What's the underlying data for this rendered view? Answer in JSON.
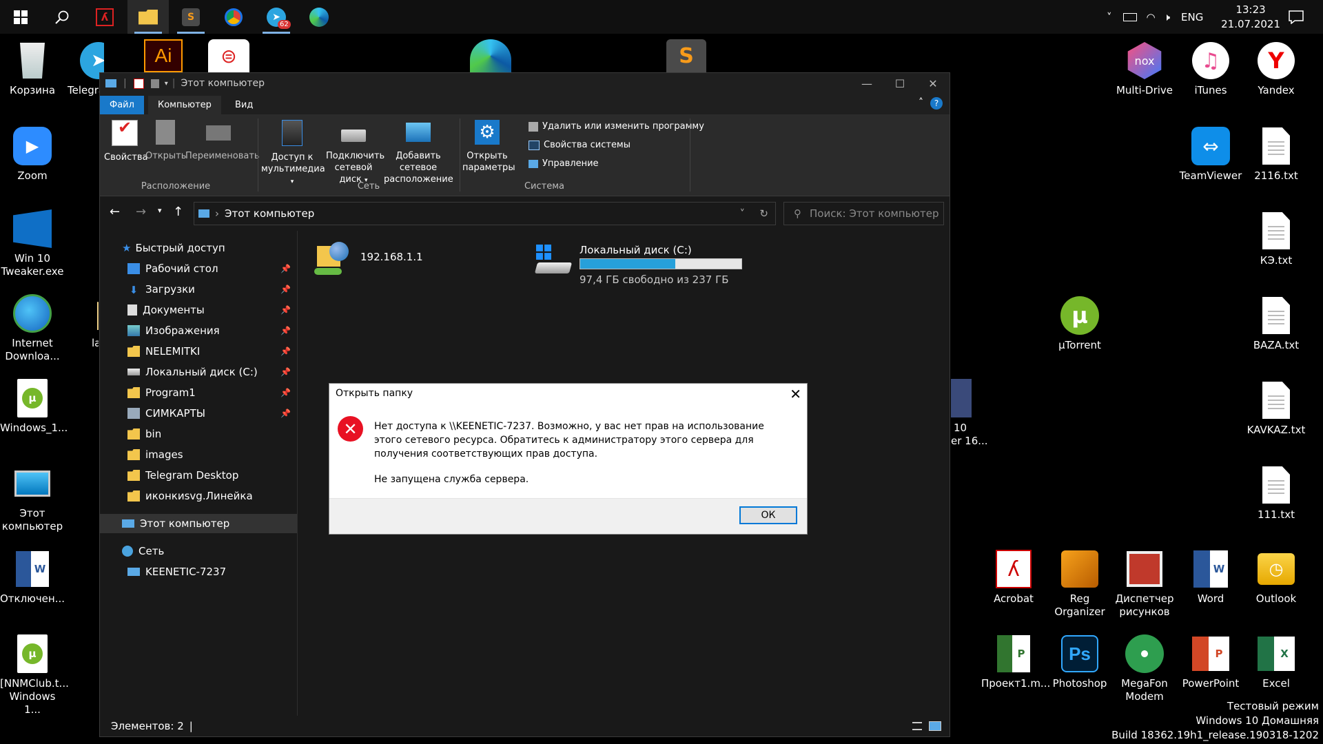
{
  "taskbar": {
    "language": "ENG",
    "time": "13:23",
    "date": "21.07.2021",
    "telegram_badge": "62"
  },
  "desktop_left": [
    {
      "label": "Корзина"
    },
    {
      "label": "Telegra"
    },
    {
      "label": "Zoom"
    },
    {
      "label": "Win 10 Tweaker.exe"
    },
    {
      "label": "Internet Downloa..."
    },
    {
      "label": "lavend"
    },
    {
      "label": "Windows_1..."
    },
    {
      "label": "Этот компьютер"
    },
    {
      "label": "Отключен..."
    },
    {
      "label": "[NNMClub.t... Windows 1..."
    }
  ],
  "desktop_right": [
    {
      "label": "Multi-Drive"
    },
    {
      "label": "iTunes"
    },
    {
      "label": "Yandex"
    },
    {
      "label": "TeamViewer"
    },
    {
      "label": "2116.txt"
    },
    {
      "label": "КЭ.txt"
    },
    {
      "label": "µTorrent"
    },
    {
      "label": "BAZA.txt"
    },
    {
      "label": "KAVKAZ.txt"
    },
    {
      "label": "111.txt"
    },
    {
      "label": "Acrobat"
    },
    {
      "label": "Reg Organizer"
    },
    {
      "label": "Диспетчер рисунков"
    },
    {
      "label": "Word"
    },
    {
      "label": "Outlook"
    },
    {
      "label": "Проект1.m..."
    },
    {
      "label": "Photoshop"
    },
    {
      "label": "MegaFon Modem"
    },
    {
      "label": "PowerPoint"
    },
    {
      "label": "Excel"
    }
  ],
  "partial_icon": {
    "line1": "10",
    "line2": "er 16..."
  },
  "explorer": {
    "title": "Этот компьютер",
    "tabs": {
      "file": "Файл",
      "computer": "Компьютер",
      "view": "Вид"
    },
    "ribbon": {
      "properties": "Свойства",
      "open": "Открыть",
      "rename": "Переименовать",
      "group_location": "Расположение",
      "media_access": "Доступ к мультимедиа",
      "map_drive": "Подключить сетевой диск",
      "add_net_location": "Добавить сетевое расположение",
      "group_network": "Сеть",
      "open_settings": "Открыть параметры",
      "uninstall": "Удалить или изменить программу",
      "system_props": "Свойства системы",
      "manage": "Управление",
      "group_system": "Система"
    },
    "address": "Этот компьютер",
    "search_placeholder": "Поиск: Этот компьютер",
    "nav": {
      "quick_access": "Быстрый доступ",
      "items": [
        {
          "label": "Рабочий стол",
          "pinned": true
        },
        {
          "label": "Загрузки",
          "pinned": true
        },
        {
          "label": "Документы",
          "pinned": true
        },
        {
          "label": "Изображения",
          "pinned": true
        },
        {
          "label": "NELEMITKI",
          "pinned": true
        },
        {
          "label": "Локальный диск (C:)",
          "pinned": true
        },
        {
          "label": "Program1",
          "pinned": true
        },
        {
          "label": "СИМКАРТЫ",
          "pinned": true
        },
        {
          "label": "bin",
          "pinned": false
        },
        {
          "label": "images",
          "pinned": false
        },
        {
          "label": "Telegram Desktop",
          "pinned": false
        },
        {
          "label": "иконкиsvg.Линейка",
          "pinned": false
        }
      ],
      "this_pc": "Этот компьютер",
      "network": "Сеть",
      "network_device": "KEENETIC-7237"
    },
    "content": {
      "network_location": "192.168.1.1",
      "drive_name": "Локальный диск (C:)",
      "drive_free": "97,4 ГБ свободно из 237 ГБ",
      "drive_used_fraction": 0.589
    },
    "status": "Элементов: 2"
  },
  "dialog": {
    "title": "Открыть папку",
    "message": "Нет доступа к \\\\KEENETIC-7237. Возможно, у вас нет прав на использование этого сетевого ресурса. Обратитесь к администратору этого сервера для получения соответствующих прав доступа.",
    "detail": "Не запущена служба сервера.",
    "ok": "ОК"
  },
  "watermark": {
    "line1": "Тестовый режим",
    "line2": "Windows 10 Домашняя",
    "line3": "Build 18362.19h1_release.190318-1202"
  },
  "colors": {
    "accent": "#1979ca",
    "error": "#e81123",
    "drive_bar": "#26a0da"
  }
}
